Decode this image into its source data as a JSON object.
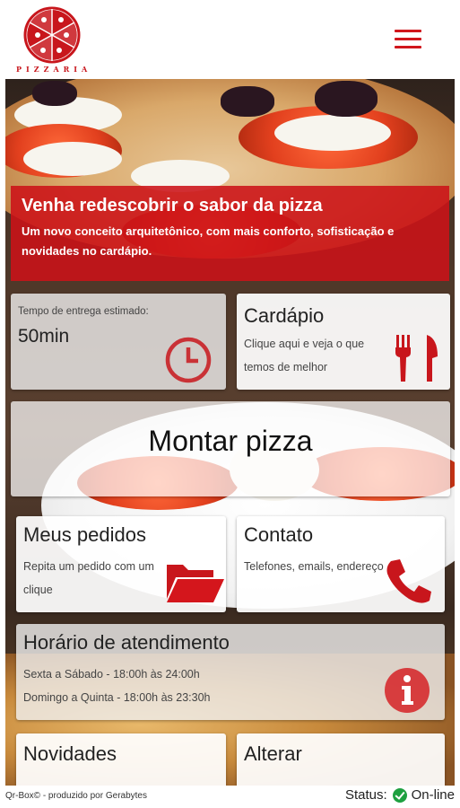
{
  "header": {
    "logo_word": "PIZZARIA",
    "menu_icon": "hamburger-menu-icon"
  },
  "hero": {
    "title": "Venha redescobrir o sabor da pizza",
    "subtitle_line1": "Um novo conceito arquitetônico, com mais conforto, sofisticação e",
    "subtitle_line2": "novidades no cardápio."
  },
  "delivery": {
    "label": "Tempo de entrega estimado:",
    "value": "50min",
    "icon": "clock-icon"
  },
  "cardapio": {
    "title": "Cardápio",
    "text_line1": "Clique aqui e veja o que",
    "text_line2": "temos de melhor",
    "icon": "cutlery-icon"
  },
  "montar": {
    "title": "Montar pizza"
  },
  "pedidos": {
    "title": "Meus pedidos",
    "text_line1": "Repita um pedido com um",
    "text_line2": "clique",
    "icon": "folder-icon"
  },
  "contato": {
    "title": "Contato",
    "text_line1": "Telefones, emails, endereço",
    "icon": "phone-icon"
  },
  "horario": {
    "title": "Horário de atendimento",
    "line1": "Sexta a Sábado - 18:00h às 24:00h",
    "line2": "Domingo a Quinta - 18:00h às 23:30h",
    "icon": "info-icon"
  },
  "novidades": {
    "title": "Novidades"
  },
  "alterar": {
    "title": "Alterar"
  },
  "footer": {
    "credit": "Qr-Box© - produzido por Gerabytes",
    "status_label": "Status:",
    "status_value": "On-line"
  },
  "colors": {
    "brand_red": "#cc1218",
    "status_green": "#1ea040"
  }
}
